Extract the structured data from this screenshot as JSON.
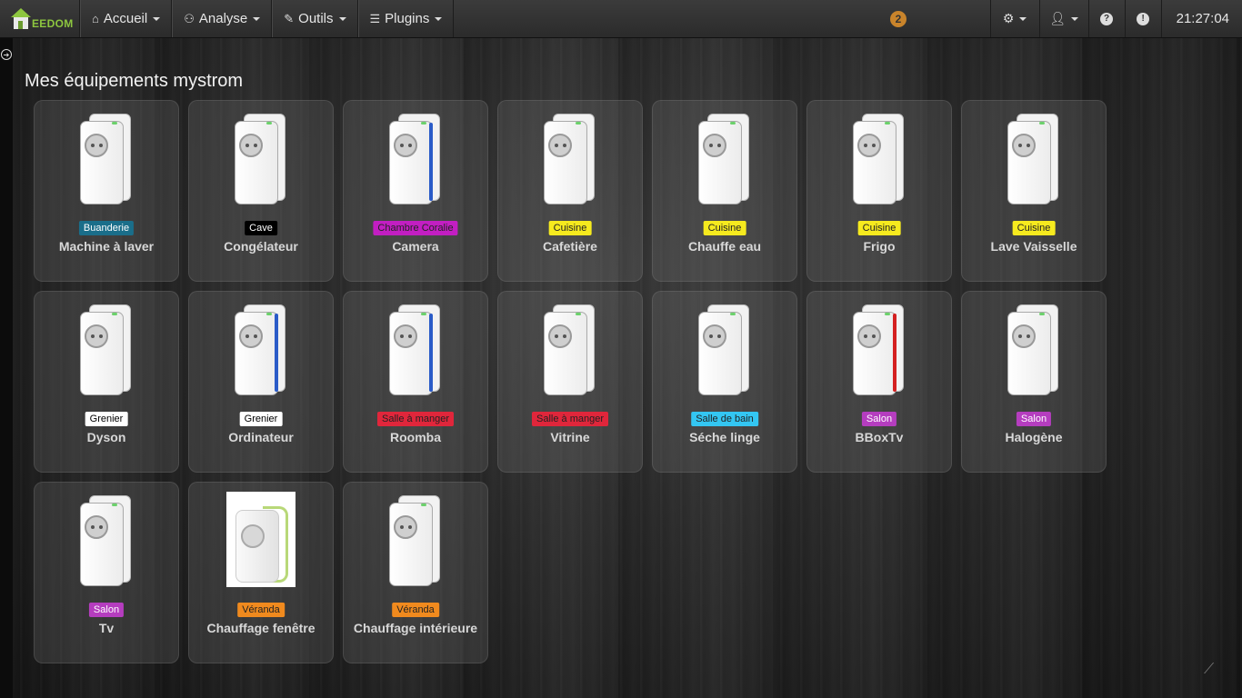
{
  "navbar": {
    "brand": "EEDOM",
    "menus": [
      {
        "label": "Accueil",
        "icon": "home-icon"
      },
      {
        "label": "Analyse",
        "icon": "analyse-icon"
      },
      {
        "label": "Outils",
        "icon": "wrench-icon"
      },
      {
        "label": "Plugins",
        "icon": "list-icon"
      }
    ],
    "notification_count": "2",
    "clock": "21:27:04"
  },
  "page_title": "Mes équipements mystrom",
  "colors": {
    "Buanderie": {
      "bg": "#1a6e8a",
      "fg": "#ffffff"
    },
    "Cave": {
      "bg": "#000000",
      "fg": "#ffffff"
    },
    "Chambre Coralie": {
      "bg": "#c21ec2",
      "fg": "#222222"
    },
    "Cuisine": {
      "bg": "#f6ea1e",
      "fg": "#222222"
    },
    "Grenier": {
      "bg": "#ffffff",
      "fg": "#000000"
    },
    "Salle à manger": {
      "bg": "#e0263b",
      "fg": "#222222"
    },
    "Salle de bain": {
      "bg": "#33c6f2",
      "fg": "#222222"
    },
    "Salon": {
      "bg": "#b53dbf",
      "fg": "#ffffff"
    },
    "Véranda": {
      "bg": "#f08a1e",
      "fg": "#222222"
    }
  },
  "equipments": [
    {
      "room": "Buanderie",
      "name": "Machine à laver",
      "stripe": "none"
    },
    {
      "room": "Cave",
      "name": "Congélateur",
      "stripe": "none"
    },
    {
      "room": "Chambre Coralie",
      "name": "Camera",
      "stripe": "#2a5bc8"
    },
    {
      "room": "Cuisine",
      "name": "Cafetière",
      "stripe": "none"
    },
    {
      "room": "Cuisine",
      "name": "Chauffe eau",
      "stripe": "none"
    },
    {
      "room": "Cuisine",
      "name": "Frigo",
      "stripe": "none"
    },
    {
      "room": "Cuisine",
      "name": "Lave Vaisselle",
      "stripe": "none"
    },
    {
      "room": "Grenier",
      "name": "Dyson",
      "stripe": "none"
    },
    {
      "room": "Grenier",
      "name": "Ordinateur",
      "stripe": "#2a5bc8"
    },
    {
      "room": "Salle à manger",
      "name": "Roomba",
      "stripe": "#2a5bc8"
    },
    {
      "room": "Salle à manger",
      "name": "Vitrine",
      "stripe": "none"
    },
    {
      "room": "Salle de bain",
      "name": "Séche linge",
      "stripe": "none"
    },
    {
      "room": "Salon",
      "name": "BBoxTv",
      "stripe": "#d42020"
    },
    {
      "room": "Salon",
      "name": "Halogène",
      "stripe": "none"
    },
    {
      "room": "Salon",
      "name": "Tv",
      "stripe": "none"
    },
    {
      "room": "Véranda",
      "name": "Chauffage fenêtre",
      "stripe": "photo"
    },
    {
      "room": "Véranda",
      "name": "Chauffage intérieure",
      "stripe": "none"
    }
  ]
}
